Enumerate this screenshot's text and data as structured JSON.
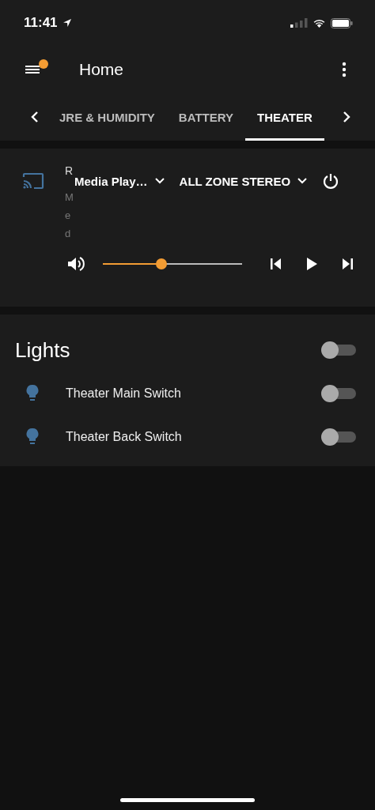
{
  "status_bar": {
    "time": "11:41"
  },
  "header": {
    "title": "Home",
    "menu_notification": true
  },
  "tabs": [
    {
      "label": "JRE & HUMIDITY",
      "selected": false
    },
    {
      "label": "BATTERY",
      "selected": false
    },
    {
      "label": "THEATER",
      "selected": true
    }
  ],
  "media_player": {
    "name": "R",
    "state_text": "Med",
    "source": "Media Play…",
    "sound_mode": "ALL ZONE STEREO",
    "volume": {
      "level": 0.42
    }
  },
  "lights": {
    "title": "Lights",
    "on": false,
    "entities": [
      {
        "name": "Theater Main Switch",
        "on": false
      },
      {
        "name": "Theater Back Switch",
        "on": false
      }
    ]
  }
}
